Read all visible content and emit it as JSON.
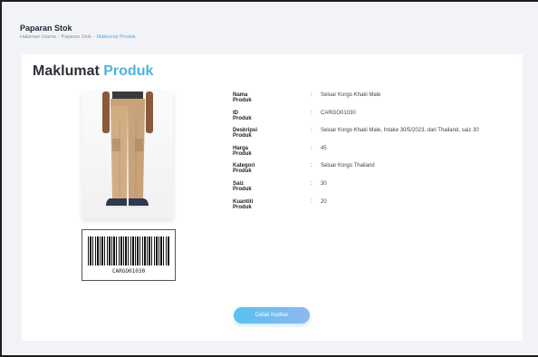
{
  "header": {
    "title": "Paparan Stok",
    "breadcrumb": [
      "Halaman Utama",
      "Paparan Stok",
      "Maklumat Produk"
    ]
  },
  "card": {
    "title_main": "Maklumat",
    "title_accent": "Produk"
  },
  "barcode": {
    "code": "CARGO01030"
  },
  "details": [
    {
      "label": "Nama Produk",
      "value": "Seluar Korgo Khaki Male"
    },
    {
      "label": "ID Produk",
      "value": "CARGO01030"
    },
    {
      "label": "Deskripsi Produk",
      "value": "Seluar Korgo Khaki Male, Intake 30/5/2023, dari Thailand, saiz 30"
    },
    {
      "label": "Harga Produk",
      "value": "45"
    },
    {
      "label": "Kategori Produk",
      "value": "Seluar Korgo Thailand"
    },
    {
      "label": "Saiz Produk",
      "value": "30"
    },
    {
      "label": "Kuantiti Produk",
      "value": "20"
    }
  ],
  "actions": {
    "print_barcode_label": "Cetak Kodbar"
  },
  "colors": {
    "accent": "#4fb3e0",
    "button_start": "#58c1ee",
    "button_end": "#8fb7f0"
  }
}
